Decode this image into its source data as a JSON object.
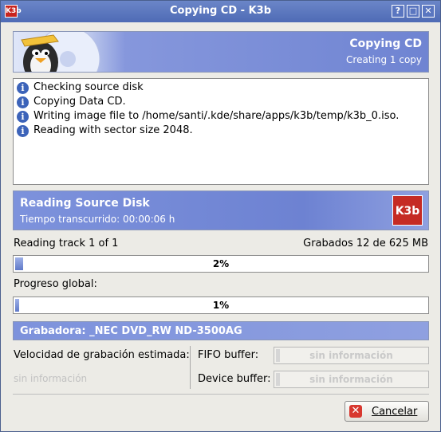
{
  "window": {
    "title": "Copying CD - K3b",
    "app_icon": "K3b"
  },
  "titlebar_buttons": {
    "help": "?",
    "maximize": "□",
    "close": "✕"
  },
  "banner": {
    "title": "Copying CD",
    "subtitle": "Creating 1 copy"
  },
  "log": [
    {
      "icon": "info-icon",
      "text": "Checking source disk"
    },
    {
      "icon": "info-icon",
      "text": "Copying Data CD."
    },
    {
      "icon": "info-icon",
      "text": "Writing image file to /home/santi/.kde/share/apps/k3b/temp/k3b_0.iso."
    },
    {
      "icon": "info-icon",
      "text": "Reading with sector size 2048."
    }
  ],
  "status": {
    "title": "Reading Source Disk",
    "elapsed": "Tiempo transcurrido: 00:00:06 h",
    "logo": "K3b"
  },
  "track": {
    "label": "Reading track 1 of 1",
    "written": "Grabados 12 de 625 MB",
    "progress_text": "2%",
    "progress_percent": 2
  },
  "global": {
    "label": "Progreso global:",
    "progress_text": "1%",
    "progress_percent": 1
  },
  "writer": {
    "label": "Grabadora: _NEC DVD_RW ND-3500AG"
  },
  "speed": {
    "label": "Velocidad de grabación estimada:",
    "value": "sin información"
  },
  "fifo": {
    "label": "FIFO buffer:",
    "value": "sin información"
  },
  "device": {
    "label": "Device buffer:",
    "value": "sin información"
  },
  "cancel": {
    "label": "Cancelar"
  },
  "colors": {
    "titlebar": "#5a76c0",
    "accent": "#7d92dc",
    "brand_red": "#c52b24"
  }
}
